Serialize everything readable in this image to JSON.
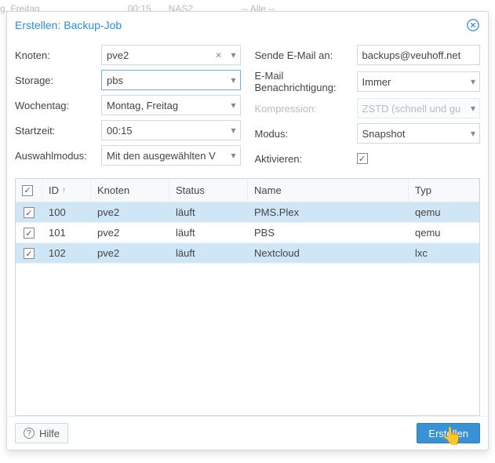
{
  "backdrop": {
    "col1": "g, Freitag",
    "col2": "00:15",
    "col3": "NAS2",
    "col4": "-- Alle --"
  },
  "window": {
    "title": "Erstellen: Backup-Job",
    "left": [
      {
        "label": "Knoten:",
        "value": "pve2",
        "clear": true,
        "chev": true
      },
      {
        "label": "Storage:",
        "value": "pbs",
        "clear": false,
        "chev": true,
        "highlight": true
      },
      {
        "label": "Wochentag:",
        "value": "Montag, Freitag",
        "clear": false,
        "chev": true
      },
      {
        "label": "Startzeit:",
        "value": "00:15",
        "clear": false,
        "chev": true
      },
      {
        "label": "Auswahlmodus:",
        "value": "Mit den ausgewählten V",
        "clear": false,
        "chev": true
      }
    ],
    "right": [
      {
        "label": "Sende E-Mail an:",
        "value": "backups@veuhoff.net",
        "type": "text"
      },
      {
        "label": "E-Mail Benachrichtigung:",
        "value": "Immer",
        "chev": true
      },
      {
        "label": "Kompression:",
        "value": "ZSTD (schnell und gut)",
        "chev": true,
        "disabled": true
      },
      {
        "label": "Modus:",
        "value": "Snapshot",
        "chev": true
      },
      {
        "label": "Aktivieren:",
        "checked": true,
        "type": "checkbox"
      }
    ],
    "table": {
      "headers": {
        "id": "ID",
        "knoten": "Knoten",
        "status": "Status",
        "name": "Name",
        "typ": "Typ"
      },
      "rows": [
        {
          "checked": true,
          "id": "100",
          "knoten": "pve2",
          "status": "läuft",
          "name": "PMS.Plex",
          "typ": "qemu",
          "sel": true
        },
        {
          "checked": true,
          "id": "101",
          "knoten": "pve2",
          "status": "läuft",
          "name": "PBS",
          "typ": "qemu",
          "sel": false
        },
        {
          "checked": true,
          "id": "102",
          "knoten": "pve2",
          "status": "läuft",
          "name": "Nextcloud",
          "typ": "lxc",
          "sel": true
        }
      ]
    },
    "footer": {
      "help": "Hilfe",
      "submit": "Erstellen"
    }
  }
}
